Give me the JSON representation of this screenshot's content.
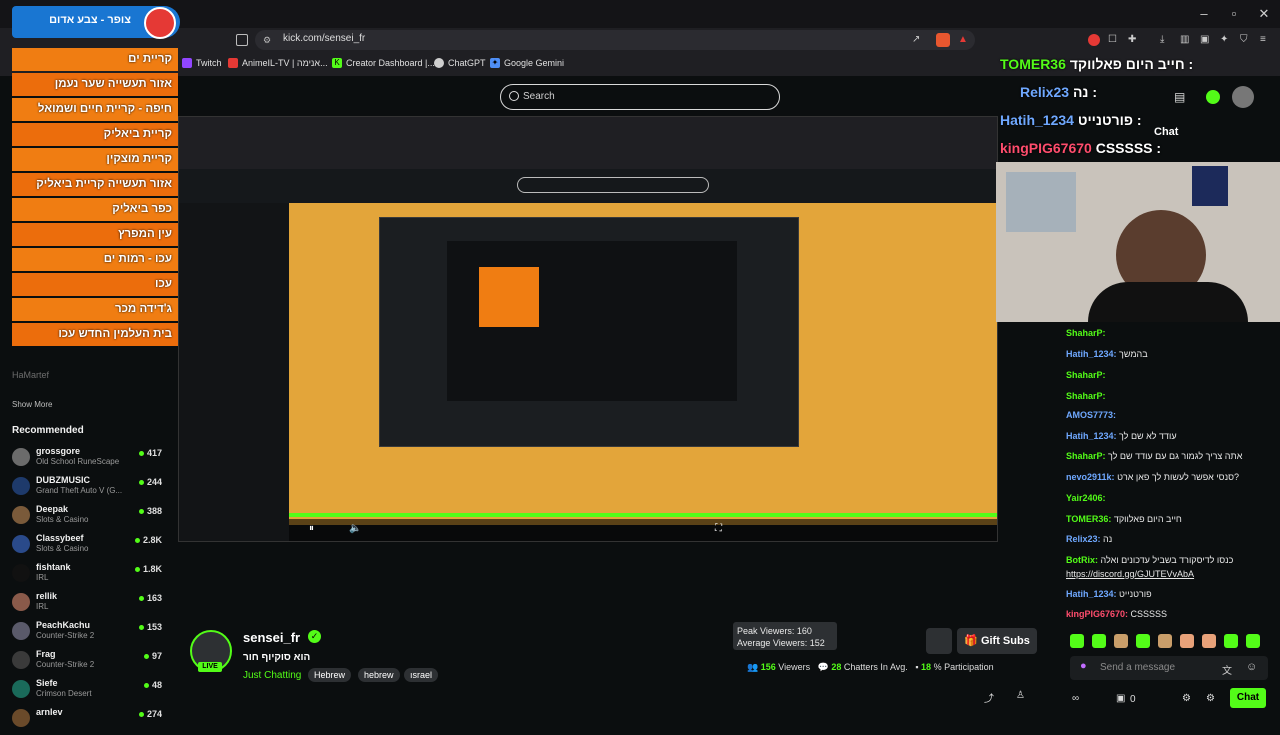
{
  "browser": {
    "url": "kick.com/sensei_fr",
    "bookmarks": [
      {
        "label": "Twitch",
        "color": "#9146ff"
      },
      {
        "label": "AnimeIL-TV | אנימה...",
        "color": "#e53935"
      },
      {
        "label": "Creator Dashboard |...",
        "color": "#53fc18"
      },
      {
        "label": "ChatGPT",
        "color": "#cfcfcf"
      },
      {
        "label": "Google Gemini",
        "color": "#4f8ff7"
      }
    ]
  },
  "search": {
    "placeholder": "Search"
  },
  "alert": {
    "header": "צופר - צבע אדום",
    "locations": [
      "קריית ים",
      "אזור תעשייה שער נעמן",
      "חיפה - קריית חיים ושמואל",
      "קריית ביאליק",
      "קריית מוצקין",
      "אזור תעשייה קריית ביאליק",
      "כפר ביאליק",
      "עין המפרץ",
      "עכו - רמות ים",
      "עכו",
      "ג'דידה מכר",
      "בית העלמין החדש עכו"
    ]
  },
  "sidebar": {
    "faded_item": "HaMartef",
    "show_more": "Show More",
    "recommended_title": "Recommended",
    "recommended": [
      {
        "name": "grossgore",
        "game": "Old School RuneScape",
        "viewers": "417"
      },
      {
        "name": "DUBZMUSIC",
        "game": "Grand Theft Auto V (G...",
        "viewers": "244"
      },
      {
        "name": "Deepak",
        "game": "Slots & Casino",
        "viewers": "388"
      },
      {
        "name": "Classybeef",
        "game": "Slots & Casino",
        "viewers": "2.8K"
      },
      {
        "name": "fishtank",
        "game": "IRL",
        "viewers": "1.8K"
      },
      {
        "name": "rellik",
        "game": "IRL",
        "viewers": "163"
      },
      {
        "name": "PeachKachu",
        "game": "Counter-Strike 2",
        "viewers": "153"
      },
      {
        "name": "Frag",
        "game": "Counter-Strike 2",
        "viewers": "97"
      },
      {
        "name": "Siefe",
        "game": "Crimson Desert",
        "viewers": "48"
      },
      {
        "name": "arnlev",
        "game": "",
        "viewers": "274"
      }
    ]
  },
  "stream": {
    "streamer": "sensei_fr",
    "live": "LIVE",
    "title": "הוא סוקיוף חור",
    "category": "Just Chatting",
    "tags": [
      "Hebrew",
      "hebrew",
      "ısrael"
    ],
    "gift_subs": "Gift Subs",
    "viewers": "156",
    "viewers_label": "Viewers",
    "chatters": "28",
    "chatters_label": "Chatters In Avg.",
    "participation": "18",
    "participation_label": "% Participation",
    "peak_viewers": "Peak Viewers: 160",
    "avg_viewers": "Average Viewers: 152"
  },
  "chat": {
    "header": "Chat",
    "overlay_messages": [
      {
        "user": "TOMER36",
        "text": "חייב היום פאלווקד :",
        "color": "#53fc18"
      },
      {
        "user": "Relix23",
        "text": "נה :",
        "color": "#6fa8ff"
      },
      {
        "user": "Hatih_1234",
        "text": "פורטנייט :",
        "color": "#6fa8ff"
      },
      {
        "user": "kingPIG67670",
        "text": "CSSSSS :",
        "color": "#ff4d6d"
      }
    ],
    "messages": [
      {
        "user": "ShaharP:",
        "text": "",
        "color": "#53fc18"
      },
      {
        "user": "Hatih_1234:",
        "text": "בהמשך",
        "color": "#6fa8ff"
      },
      {
        "user": "ShaharP:",
        "text": "",
        "color": "#53fc18"
      },
      {
        "user": "ShaharP:",
        "text": "",
        "color": "#53fc18"
      },
      {
        "user": "AMOS7773:",
        "text": "",
        "color": "#6fa8ff"
      },
      {
        "user": "Hatih_1234:",
        "text": "עודד לא שם לך",
        "color": "#6fa8ff"
      },
      {
        "user": "ShaharP:",
        "text": "אתה צריך לגמור גם עם עודד שם לך",
        "color": "#53fc18"
      },
      {
        "user": "nevo2911k:",
        "text": "סנסי אפשר לעשות לך פאן ארט?",
        "color": "#6fa8ff"
      },
      {
        "user": "Yair2406:",
        "text": "",
        "color": "#53fc18"
      },
      {
        "user": "TOMER36:",
        "text": "חייב היום פאלווקד",
        "color": "#53fc18"
      },
      {
        "user": "Relix23:",
        "text": "נה",
        "color": "#6fa8ff"
      },
      {
        "user": "BotRix:",
        "text": "כנסו לדיסקורד בשביל עדכונים ואלה",
        "color": "#53fc18"
      },
      {
        "user": "",
        "text": "https://discord.gg/GJUTEVvAbA",
        "color": "#ffffff"
      },
      {
        "user": "Hatih_1234:",
        "text": "פורטנייט",
        "color": "#6fa8ff"
      },
      {
        "user": "kingPIG67670:",
        "text": "CSSSSS",
        "color": "#ff4d6d"
      }
    ],
    "input_placeholder": "Send a message",
    "send_label": "Chat",
    "points": "0"
  },
  "colors": {
    "accent": "#53fc18",
    "background": "#0b0e0f",
    "alert_orange": "#f07d12",
    "alert_blue": "#1976d2"
  }
}
